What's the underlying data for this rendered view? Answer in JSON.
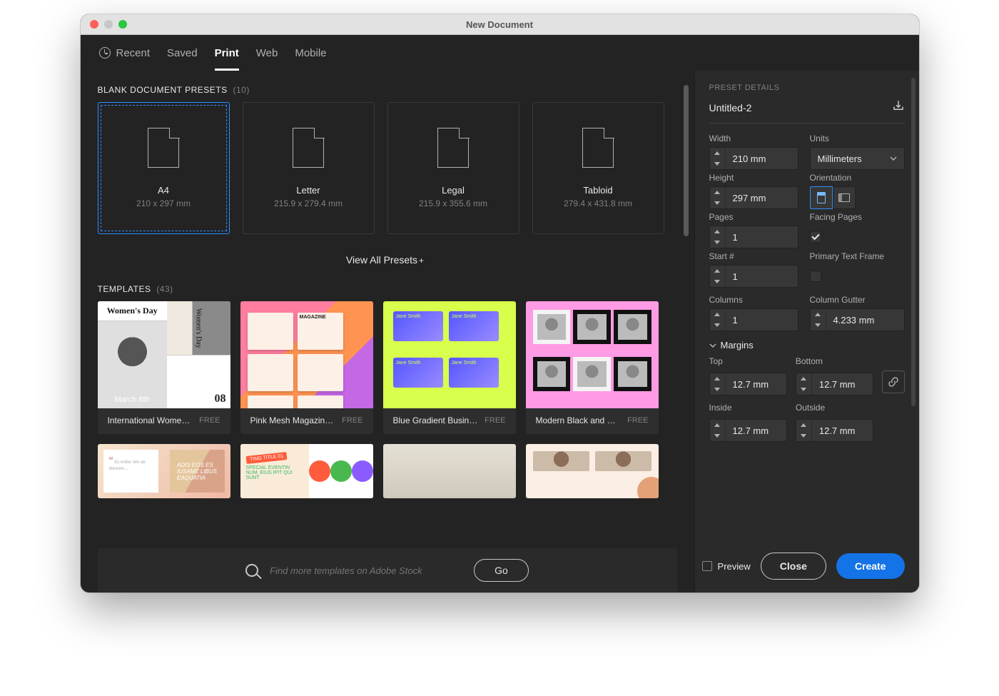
{
  "window": {
    "title": "New Document"
  },
  "tabs": {
    "recent": "Recent",
    "saved": "Saved",
    "print": "Print",
    "web": "Web",
    "mobile": "Mobile",
    "active": "print"
  },
  "presets": {
    "heading": "BLANK DOCUMENT PRESETS",
    "count": "(10)",
    "items": [
      {
        "title": "A4",
        "size": "210 x 297 mm",
        "selected": true
      },
      {
        "title": "Letter",
        "size": "215.9 x 279.4 mm",
        "selected": false
      },
      {
        "title": "Legal",
        "size": "215.9 x 355.6 mm",
        "selected": false
      },
      {
        "title": "Tabloid",
        "size": "279.4 x 431.8 mm",
        "selected": false
      }
    ],
    "viewAll": "View All Presets"
  },
  "templates": {
    "heading": "TEMPLATES",
    "count": "(43)",
    "items": [
      {
        "name": "International Wome…",
        "price": "FREE"
      },
      {
        "name": "Pink Mesh Magazine…",
        "price": "FREE"
      },
      {
        "name": "Blue Gradient Busine…",
        "price": "FREE"
      },
      {
        "name": "Modern Black and W…",
        "price": "FREE"
      }
    ],
    "thumbText": {
      "t1_banner": "Women's Day",
      "t1_overlay": "March 8th",
      "t1_side": "Women's Day",
      "t3_name": "Jane Smith"
    }
  },
  "search": {
    "placeholder": "Find more templates on Adobe Stock",
    "goLabel": "Go"
  },
  "details": {
    "heading": "PRESET DETAILS",
    "docName": "Untitled-2",
    "widthLabel": "Width",
    "widthValue": "210 mm",
    "unitsLabel": "Units",
    "unitsValue": "Millimeters",
    "heightLabel": "Height",
    "heightValue": "297 mm",
    "orientationLabel": "Orientation",
    "pagesLabel": "Pages",
    "pagesValue": "1",
    "facingLabel": "Facing Pages",
    "facingChecked": true,
    "startLabel": "Start #",
    "startValue": "1",
    "primaryTFLabel": "Primary Text Frame",
    "primaryTFChecked": false,
    "columnsLabel": "Columns",
    "columnsValue": "1",
    "gutterLabel": "Column Gutter",
    "gutterValue": "4.233 mm",
    "marginsLabel": "Margins",
    "topLabel": "Top",
    "topValue": "12.7 mm",
    "bottomLabel": "Bottom",
    "bottomValue": "12.7 mm",
    "insideLabel": "Inside",
    "insideValue": "12.7 mm",
    "outsideLabel": "Outside",
    "outsideValue": "12.7 mm"
  },
  "footer": {
    "previewLabel": "Preview",
    "closeLabel": "Close",
    "createLabel": "Create"
  }
}
